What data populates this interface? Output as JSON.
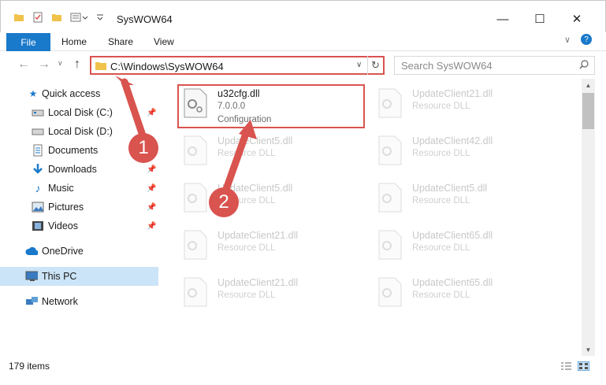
{
  "window": {
    "title": "SysWOW64",
    "minimize": "—",
    "maximize": "☐",
    "close": "✕"
  },
  "ribbon": {
    "file": "File",
    "home": "Home",
    "share": "Share",
    "view": "View"
  },
  "navigation": {
    "back": "←",
    "forward": "→",
    "up": "↑",
    "address": "C:\\Windows\\SysWOW64",
    "search_placeholder": "Search SysWOW64"
  },
  "sidebar": {
    "items": [
      {
        "label": "Quick access",
        "icon": "star-icon"
      },
      {
        "label": "Local Disk (C:)",
        "icon": "drive-icon"
      },
      {
        "label": "Local Disk (D:)",
        "icon": "drive-icon"
      },
      {
        "label": "Documents",
        "icon": "documents-icon"
      },
      {
        "label": "Downloads",
        "icon": "download-icon"
      },
      {
        "label": "Music",
        "icon": "music-icon"
      },
      {
        "label": "Pictures",
        "icon": "pictures-icon"
      },
      {
        "label": "Videos",
        "icon": "videos-icon"
      },
      {
        "label": "OneDrive",
        "icon": "cloud-icon"
      },
      {
        "label": "This PC",
        "icon": "computer-icon"
      },
      {
        "label": "Network",
        "icon": "network-icon"
      }
    ]
  },
  "files": {
    "active": {
      "name": "u32cfg.dll",
      "version": "7.0.0.0",
      "description": "Configuration"
    },
    "faded": [
      {
        "name": "UpdateClient21.dll",
        "type": "Resource DLL"
      },
      {
        "name": "UpdateClient5.dll",
        "type": "Resource DLL"
      },
      {
        "name": "UpdateClient42.dll",
        "type": "Resource DLL"
      },
      {
        "name": "UpdateClient5.dll",
        "type": "Resource DLL"
      },
      {
        "name": "UpdateClient5.dll",
        "type": "Resource DLL"
      },
      {
        "name": "UpdateClient21.dll",
        "type": "Resource DLL"
      },
      {
        "name": "UpdateClient65.dll",
        "type": "Resource DLL"
      },
      {
        "name": "UpdateClient21.dll",
        "type": "Resource DLL"
      },
      {
        "name": "UpdateClient65.dll",
        "type": "Resource DLL"
      }
    ]
  },
  "status": {
    "count": "179 items"
  },
  "annotations": {
    "step1": "1",
    "step2": "2",
    "color": "#d9534f"
  }
}
